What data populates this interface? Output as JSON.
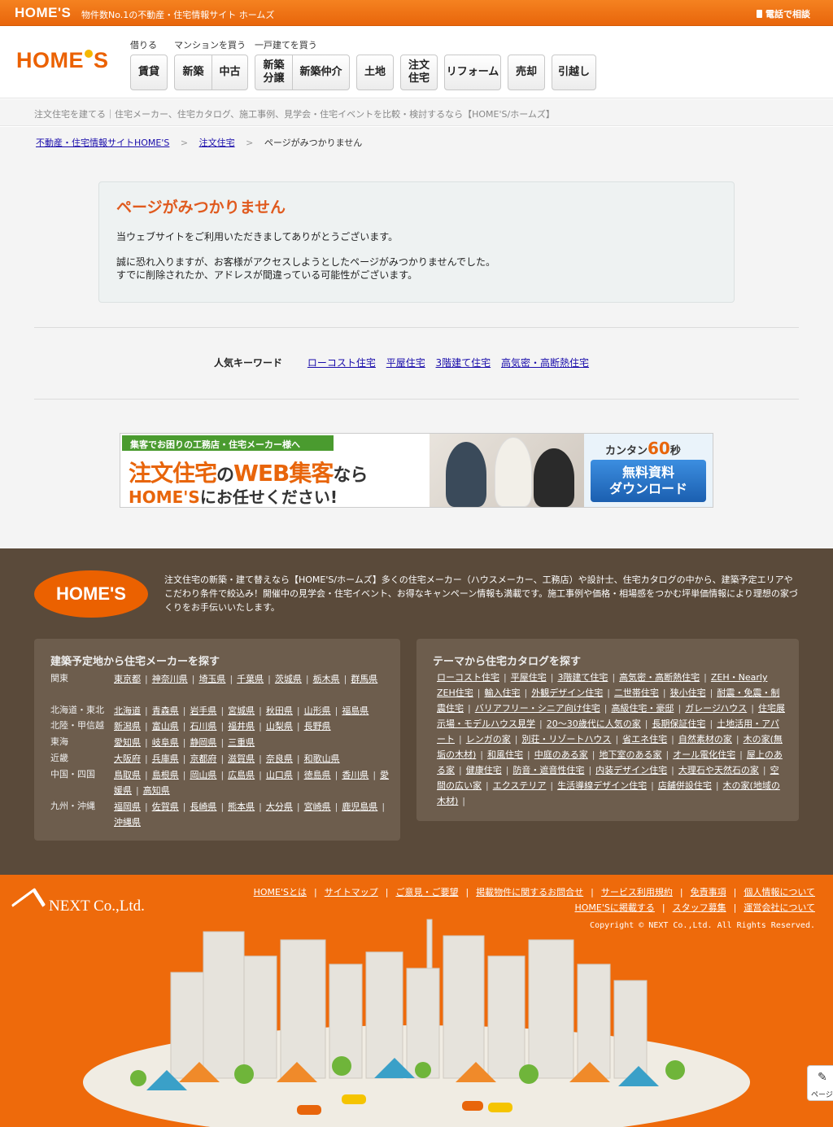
{
  "topbar": {
    "logo": "HOME'S",
    "tagline": "物件数No.1の不動産・住宅情報サイト ホームズ",
    "phone": "電話で相談"
  },
  "header": {
    "logo": "HOME'S",
    "labels": {
      "rent": "借りる",
      "mansion": "マンションを買う",
      "house": "一戸建てを買う"
    },
    "nav": {
      "chintai": "賃貸",
      "shinchiku": "新築",
      "chuko": "中古",
      "shinchiku_bunjo": "新築分譲",
      "shinchiku_chukai": "新築仲介",
      "chuko2": "中古",
      "tochi": "土地",
      "chumon": "注文住宅",
      "reform": "リフォーム",
      "baikyaku": "売却",
      "hikkoshi": "引越し"
    }
  },
  "subbar": "注文住宅を建てる｜住宅メーカー、住宅カタログ、施工事例、見学会・住宅イベントを比較・検討するなら【HOME'S/ホームズ】",
  "breadcrumb": {
    "home": "不動産・住宅情報サイトHOME'S",
    "sep": ">",
    "chumon": "注文住宅",
    "current": "ページがみつかりません"
  },
  "error": {
    "title": "ページがみつかりません",
    "line1": "当ウェブサイトをご利用いただきましてありがとうございます。",
    "line2": "誠に恐れ入りますが、お客様がアクセスしようとしたページがみつかりませんでした。",
    "line3": "すでに削除されたか、アドレスが間違っている可能性がございます。"
  },
  "keywords": {
    "label": "人気キーワード",
    "items": [
      "ローコスト住宅",
      "平屋住宅",
      "3階建て住宅",
      "高気密・高断熱住宅"
    ]
  },
  "banner": {
    "ribbon": "集客でお困りの工務店・住宅メーカー様へ",
    "headline_a": "注文住宅",
    "headline_b": "の",
    "headline_c": "WEB集客",
    "headline_d": "なら",
    "sub_a": "HOME'S",
    "sub_b": "にお任せください!",
    "timer_a": "カンタン",
    "timer_b": "60",
    "timer_c": "秒",
    "button": "無料資料\nダウンロード"
  },
  "footer": {
    "logo": "HOME'S",
    "description": "注文住宅の新築・建て替えなら【HOME'S/ホームズ】多くの住宅メーカー（ハウスメーカー、工務店）や設計士、住宅カタログの中から、建築予定エリアやこだわり条件で絞込み！開催中の見学会・住宅イベント、お得なキャンペーン情報も満載です。施工事例や価格・相場感をつかむ坪単価情報により理想の家づくりをお手伝いいたします。",
    "area_title": "建築予定地から住宅メーカーを探す",
    "areas": [
      {
        "region": "関東",
        "prefs": [
          "東京都",
          "神奈川県",
          "埼玉県",
          "千葉県",
          "茨城県",
          "栃木県",
          "群馬県"
        ]
      },
      {
        "region": "北海道・東北",
        "prefs": [
          "北海道",
          "青森県",
          "岩手県",
          "宮城県",
          "秋田県",
          "山形県",
          "福島県"
        ]
      },
      {
        "region": "北陸・甲信越",
        "prefs": [
          "新潟県",
          "富山県",
          "石川県",
          "福井県",
          "山梨県",
          "長野県"
        ]
      },
      {
        "region": "東海",
        "prefs": [
          "愛知県",
          "岐阜県",
          "静岡県",
          "三重県"
        ]
      },
      {
        "region": "近畿",
        "prefs": [
          "大阪府",
          "兵庫県",
          "京都府",
          "滋賀県",
          "奈良県",
          "和歌山県"
        ]
      },
      {
        "region": "中国・四国",
        "prefs": [
          "鳥取県",
          "島根県",
          "岡山県",
          "広島県",
          "山口県",
          "徳島県",
          "香川県",
          "愛媛県",
          "高知県"
        ]
      },
      {
        "region": "九州・沖縄",
        "prefs": [
          "福岡県",
          "佐賀県",
          "長崎県",
          "熊本県",
          "大分県",
          "宮崎県",
          "鹿児島県",
          "沖縄県"
        ]
      }
    ],
    "theme_title": "テーマから住宅カタログを探す",
    "themes": [
      "ローコスト住宅",
      "平屋住宅",
      "3階建て住宅",
      "高気密・高断熱住宅",
      "ZEH・Nearly ZEH住宅",
      "輸入住宅",
      "外観デザイン住宅",
      "二世帯住宅",
      "狭小住宅",
      "耐震・免震・制震住宅",
      "バリアフリー・シニア向け住宅",
      "高級住宅・豪邸",
      "ガレージハウス",
      "住宅展示場・モデルハウス見学",
      "20～30歳代に人気の家",
      "長期保証住宅",
      "土地活用・アパート",
      "レンガの家",
      "別荘・リゾートハウス",
      "省エネ住宅",
      "自然素材の家",
      "木の家(無垢の木材)",
      "和風住宅",
      "中庭のある家",
      "地下室のある家",
      "オール電化住宅",
      "屋上のある家",
      "健康住宅",
      "防音・遮音性住宅",
      "内装デザイン住宅",
      "大理石や天然石の家",
      "空間の広い家",
      "エクステリア",
      "生活導線デザイン住宅",
      "店舗併設住宅",
      "木の家(地域の木材)"
    ]
  },
  "bottom": {
    "company": "NEXT Co.,Ltd.",
    "links_row1": [
      "HOME'Sとは",
      "サイトマップ",
      "ご意見・ご要望",
      "掲載物件に関するお問合せ",
      "サービス利用規約",
      "免責事項",
      "個人情報について"
    ],
    "links_row2": [
      "HOME'Sに掲載する",
      "スタッフ募集",
      "運営会社について"
    ],
    "copyright": "Copyright © NEXT Co.,Ltd. All Rights Reserved."
  },
  "side_tab": "ページ",
  "colors": {
    "brand": "#eb6100",
    "footer": "#5a4a3a",
    "link": "#1a0dab",
    "error_title": "#e05a1e"
  }
}
